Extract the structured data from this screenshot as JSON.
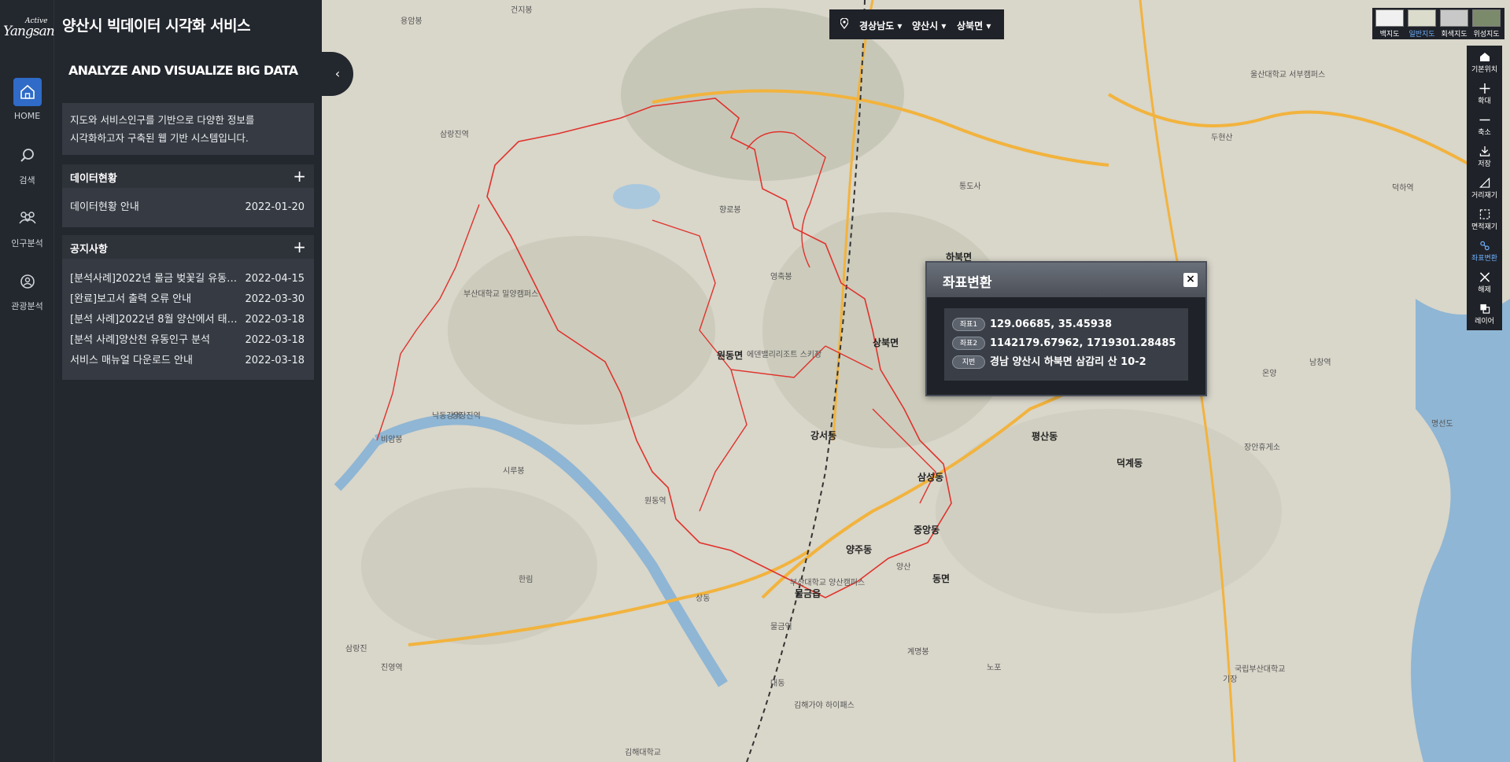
{
  "logo": {
    "small": "Active",
    "main": "Yangsan"
  },
  "nav": [
    {
      "label": "HOME",
      "icon": "home-icon",
      "active": true
    },
    {
      "label": "검색",
      "icon": "search-icon"
    },
    {
      "label": "인구분석",
      "icon": "people-icon"
    },
    {
      "label": "관광분석",
      "icon": "tourism-icon"
    }
  ],
  "panel": {
    "title": "양산시 빅데이터 시각화 서비스",
    "slogan": "ANALYZE AND VISUALIZE BIG DATA",
    "intro_line1": "지도와 서비스인구를 기반으로 다양한 정보를",
    "intro_line2": "시각화하고자 구축된 웹 기반 시스템입니다.",
    "data_status": {
      "title": "데이터현황",
      "items": [
        {
          "title": "데이터현황 안내",
          "date": "2022-01-20"
        }
      ]
    },
    "notices": {
      "title": "공지사항",
      "items": [
        {
          "title": "[분석사례]2022년 물금 벚꽃길 유동인구 분석",
          "date": "2022-04-15"
        },
        {
          "title": "[완료]보고서 출력 오류 안내",
          "date": "2022-03-30"
        },
        {
          "title": "[분석 사례]2022년 8월 양산에서 태풍 분석",
          "date": "2022-03-18"
        },
        {
          "title": "[분석 사례]양산천 유동인구 분석",
          "date": "2022-03-18"
        },
        {
          "title": "서비스 매뉴얼 다운로드 안내",
          "date": "2022-03-18"
        }
      ]
    },
    "collapse_icon": "chevron-left-icon"
  },
  "region": {
    "province": "경상남도",
    "city": "양산시",
    "district": "상북면"
  },
  "basemaps": [
    {
      "label": "백지도"
    },
    {
      "label": "일반지도",
      "selected": true
    },
    {
      "label": "회색지도"
    },
    {
      "label": "위성지도"
    }
  ],
  "tools": [
    {
      "label": "기본위치",
      "icon": "home-icon"
    },
    {
      "label": "확대",
      "icon": "zoom-in-icon"
    },
    {
      "label": "축소",
      "icon": "zoom-out-icon"
    },
    {
      "label": "저장",
      "icon": "download-icon"
    },
    {
      "label": "거리재기",
      "icon": "ruler-icon"
    },
    {
      "label": "면적재기",
      "icon": "area-icon"
    },
    {
      "label": "좌표변환",
      "icon": "coordinate-icon",
      "selected": true
    },
    {
      "label": "해제",
      "icon": "close-icon"
    },
    {
      "label": "레이어",
      "icon": "layers-icon"
    }
  ],
  "dialog": {
    "title": "좌표변환",
    "close": "×",
    "rows": [
      {
        "tag": "좌표1",
        "value": "129.06685, 35.45938"
      },
      {
        "tag": "좌표2",
        "value": "1142179.67962, 1719301.28485"
      },
      {
        "tag": "지번",
        "value": "경남 양산시 하북면 삼감리 산 10-2"
      }
    ]
  },
  "map_labels": {
    "districts": [
      "하북면",
      "원동면",
      "상북면",
      "강서동",
      "삼성동",
      "평산동",
      "덕계동",
      "양주동",
      "중앙동",
      "동면",
      "물금읍"
    ],
    "places": [
      "용암봉",
      "건지봉",
      "삼랑진역",
      "낙동강역",
      "비암봉",
      "시루봉",
      "한림",
      "진영역",
      "삼랑진",
      "상장진역",
      "부산대학교 밀양캠퍼스",
      "에덴밸리리조트 스키장",
      "영축봉",
      "향로봉",
      "양산",
      "통도사",
      "울산대학교 서부캠퍼스",
      "두현산",
      "덕하역",
      "명선도",
      "온양",
      "남창역",
      "장안휴게소",
      "기장",
      "국립부산대학교",
      "계명봉",
      "노포",
      "김해가야 하이패스",
      "김해대학교",
      "대동",
      "물금역",
      "부산대학교 양산캠퍼스",
      "상동",
      "원동역"
    ]
  }
}
